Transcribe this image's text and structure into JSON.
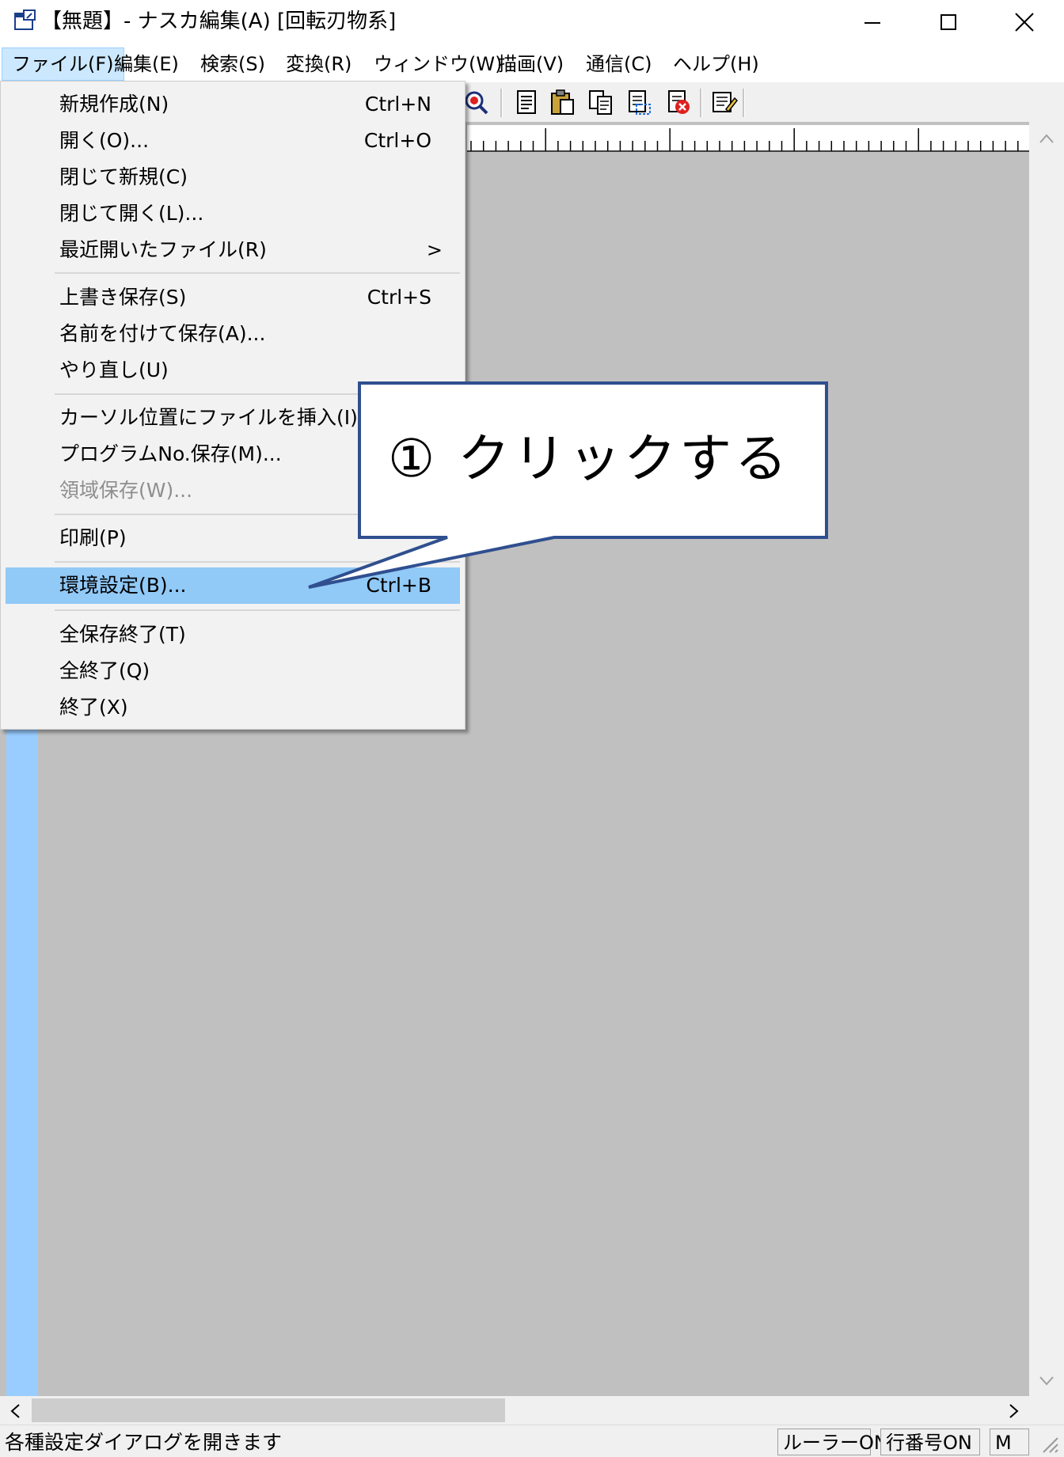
{
  "window": {
    "title": "【無題】- ナスカ編集(A) [回転刃物系]"
  },
  "menubar": {
    "items": [
      {
        "label": "ファイル(F)"
      },
      {
        "label": "編集(E)"
      },
      {
        "label": "検索(S)"
      },
      {
        "label": "変換(R)"
      },
      {
        "label": "ウィンドウ(W)"
      },
      {
        "label": "描画(V)"
      },
      {
        "label": "通信(C)"
      },
      {
        "label": "ヘルプ(H)"
      }
    ]
  },
  "file_menu": {
    "items": [
      {
        "label": "新規作成(N)",
        "shortcut": "Ctrl+N"
      },
      {
        "label": "開く(O)...",
        "shortcut": "Ctrl+O"
      },
      {
        "label": "閉じて新規(C)",
        "shortcut": ""
      },
      {
        "label": "閉じて開く(L)...",
        "shortcut": ""
      },
      {
        "label": "最近開いたファイル(R)",
        "shortcut": "",
        "submenu_arrow": ">"
      },
      {
        "label": "上書き保存(S)",
        "shortcut": "Ctrl+S"
      },
      {
        "label": "名前を付けて保存(A)...",
        "shortcut": ""
      },
      {
        "label": "やり直し(U)",
        "shortcut": ""
      },
      {
        "label": "カーソル位置にファイルを挿入(I)...",
        "shortcut": ""
      },
      {
        "label": "プログラムNo.保存(M)...",
        "shortcut": ""
      },
      {
        "label": "領域保存(W)...",
        "shortcut": "",
        "disabled": true
      },
      {
        "label": "印刷(P)",
        "shortcut": ""
      },
      {
        "label": "環境設定(B)...",
        "shortcut": "Ctrl+B",
        "highlighted": true
      },
      {
        "label": "全保存終了(T)",
        "shortcut": ""
      },
      {
        "label": "全終了(Q)",
        "shortcut": ""
      },
      {
        "label": "終了(X)",
        "shortcut": ""
      }
    ]
  },
  "callout": {
    "text": "① クリックする"
  },
  "statusbar": {
    "message": "各種設定ダイアログを開きます",
    "panels": [
      "ルーラーON",
      "行番号ON",
      "M"
    ]
  },
  "colors": {
    "menu_highlight": "#91c9f7",
    "gutter": "#99ccff",
    "editor_bg": "#c0c0c0",
    "callout_border": "#2f4f8f"
  }
}
